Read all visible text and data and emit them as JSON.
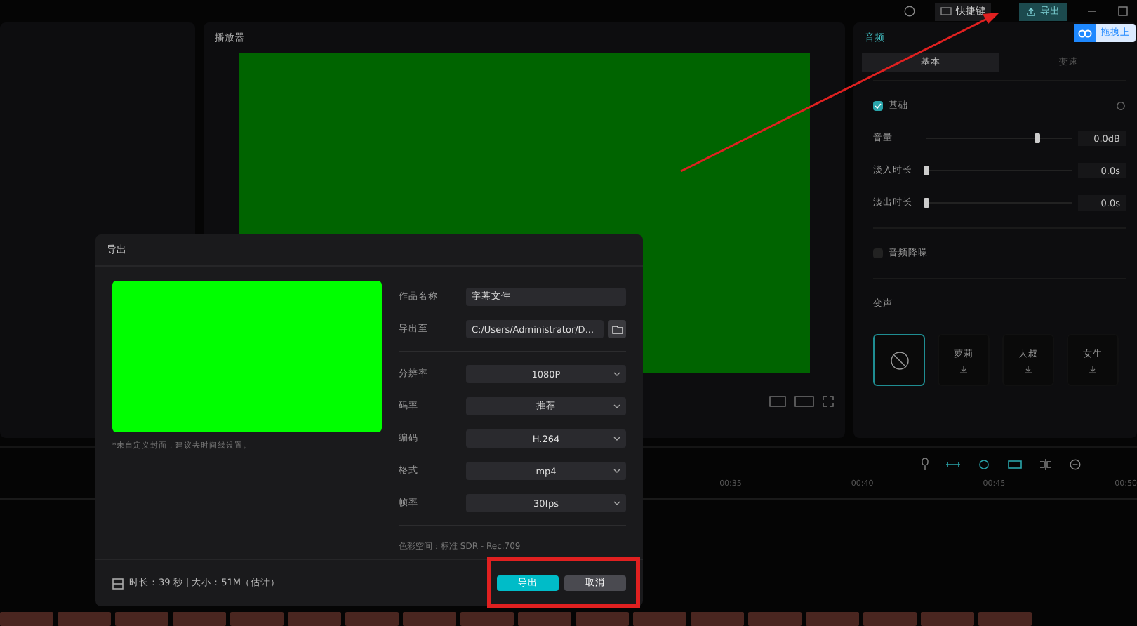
{
  "top_bar": {
    "shortcut_label": "快捷键",
    "export_label": "导出"
  },
  "floating_badge": {
    "label": "拖拽上"
  },
  "player": {
    "title": "播放器"
  },
  "right_panel": {
    "title": "音频",
    "tabs": [
      {
        "label": "基本",
        "selected": true
      },
      {
        "label": "变速",
        "selected": false
      }
    ],
    "basic": {
      "label": "基础",
      "checked": true
    },
    "sliders": [
      {
        "label": "音量",
        "level": 0.76,
        "reading": "0.0dB"
      },
      {
        "label": "淡入时长",
        "level": 0,
        "reading": "0.0s"
      },
      {
        "label": "淡出时长",
        "level": 0,
        "reading": "0.0s"
      }
    ],
    "denoise": {
      "label": "音频降噪",
      "checked": false
    },
    "voice_section": {
      "title": "变声",
      "options": [
        {
          "selected": true
        },
        {
          "label": "萝莉",
          "selected": false
        },
        {
          "label": "大叔",
          "selected": false
        },
        {
          "label": "女生",
          "selected": false
        }
      ]
    }
  },
  "timeline": {
    "ticks": [
      "00:35",
      "00:40",
      "00:45",
      "00:50"
    ]
  },
  "export_dialog": {
    "title": "导出",
    "cover_note": "*未自定义封面，建议去时间线设置。",
    "fields": [
      {
        "label": "作品名称",
        "kind": "text",
        "value": "字幕文件"
      },
      {
        "label": "导出至",
        "kind": "path",
        "value": "C:/Users/Administrator/D..."
      },
      {
        "label": "分辨率",
        "kind": "select",
        "value": "1080P"
      },
      {
        "label": "码率",
        "kind": "select",
        "value": "推荐"
      },
      {
        "label": "编码",
        "kind": "select",
        "value": "H.264"
      },
      {
        "label": "格式",
        "kind": "select",
        "value": "mp4"
      },
      {
        "label": "帧率",
        "kind": "select",
        "value": "30fps"
      }
    ],
    "color_space": "色彩空间：标准 SDR - Rec.709",
    "summary": "时长：39 秒 | 大小：51M（估计）",
    "buttons": [
      {
        "label": "导出",
        "kind": "primary"
      },
      {
        "label": "取消",
        "kind": "secondary"
      }
    ]
  }
}
